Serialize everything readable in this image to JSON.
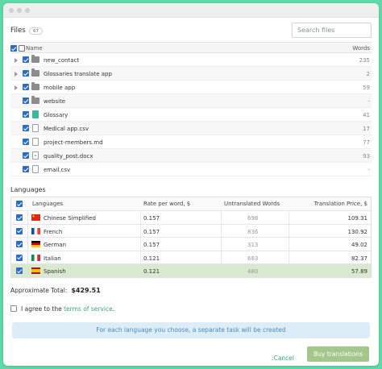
{
  "files": {
    "title": "Files",
    "count": "67",
    "search_placeholder": "Search files",
    "columns": {
      "name": "Name",
      "words": "Words"
    },
    "rows": [
      {
        "name": "new_contact",
        "words": "235",
        "kind": "folder",
        "expandable": true
      },
      {
        "name": "Glossaries translate app",
        "words": "2",
        "kind": "folder",
        "expandable": true
      },
      {
        "name": "mobile app",
        "words": "59",
        "kind": "folder",
        "expandable": true
      },
      {
        "name": "website",
        "words": "-",
        "kind": "folder",
        "expandable": false
      },
      {
        "name": "Glossary",
        "words": "41",
        "kind": "glossary",
        "expandable": false
      },
      {
        "name": "Medical app.csv",
        "words": "17",
        "kind": "file",
        "expandable": false
      },
      {
        "name": "project-members.md",
        "words": "77",
        "kind": "file",
        "expandable": false
      },
      {
        "name": "quality_post.docx",
        "words": "93",
        "kind": "docx",
        "expandable": false
      },
      {
        "name": "email.csv",
        "words": "-",
        "kind": "file",
        "expandable": false
      }
    ]
  },
  "languages": {
    "title": "Languages",
    "columns": {
      "language": "Languages",
      "rate": "Rate per word, $",
      "untranslated": "Untranslated Words",
      "price": "Translation Price, $"
    },
    "rows": [
      {
        "name": "Chinese Simplified",
        "rate": "0.157",
        "untranslated": "698",
        "price": "109.31",
        "flag": "cn",
        "selected": false
      },
      {
        "name": "French",
        "rate": "0.157",
        "untranslated": "836",
        "price": "130.92",
        "flag": "fr",
        "selected": false
      },
      {
        "name": "German",
        "rate": "0.157",
        "untranslated": "313",
        "price": "49.02",
        "flag": "de",
        "selected": false
      },
      {
        "name": "Italian",
        "rate": "0.121",
        "untranslated": "683",
        "price": "82.37",
        "flag": "it",
        "selected": false
      },
      {
        "name": "Spanish",
        "rate": "0.121",
        "untranslated": "480",
        "price": "57.89",
        "flag": "es",
        "selected": true
      }
    ]
  },
  "summary": {
    "label": "Approximate Total:",
    "value": "$429.51"
  },
  "agree": {
    "prefix": "I agree to the",
    "link": "terms of service",
    "suffix": "."
  },
  "info_message": "For each language you choose, a separate task will be created",
  "actions": {
    "cancel": ":Cancel",
    "buy": "Buy translations"
  },
  "colors": {
    "background": "#5fd9a8",
    "checkbox": "#2c6cc3",
    "accent": "#3aa66f",
    "button": "#a3c78b",
    "info_bg": "#dcedf7",
    "selected_row": "#d8e9cf"
  }
}
